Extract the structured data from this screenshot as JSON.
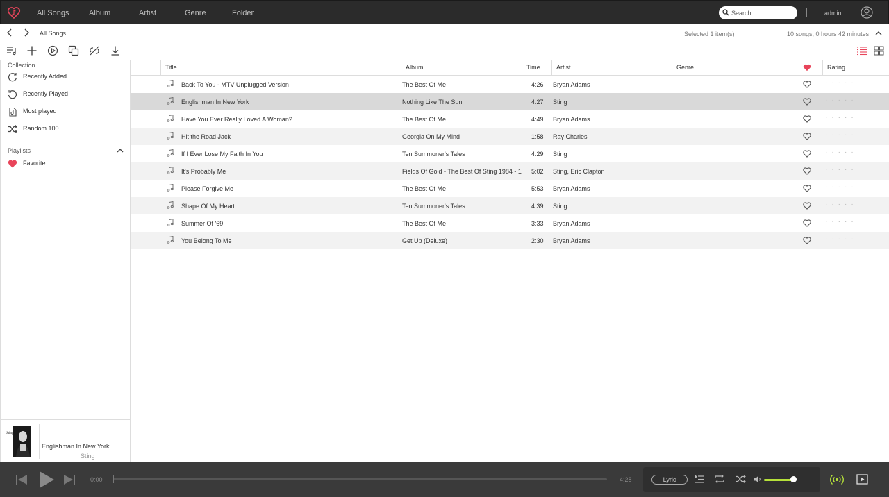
{
  "nav": {
    "items": [
      "All Songs",
      "Album",
      "Artist",
      "Genre",
      "Folder"
    ]
  },
  "search": {
    "placeholder": "Search"
  },
  "user": {
    "name": "admin"
  },
  "breadcrumb": "All Songs",
  "status": {
    "selected": "Selected 1 item(s)",
    "total": "10 songs, 0 hours 42 minutes"
  },
  "sidebar": {
    "collection_title": "Collection",
    "collection": [
      {
        "label": "Recently Added",
        "icon": "recently-added-icon"
      },
      {
        "label": "Recently Played",
        "icon": "recently-played-icon"
      },
      {
        "label": "Most played",
        "icon": "most-played-icon"
      },
      {
        "label": "Random 100",
        "icon": "shuffle-icon"
      }
    ],
    "playlists_title": "Playlists",
    "playlists": [
      {
        "label": "Favorite",
        "icon": "heart-icon"
      }
    ]
  },
  "table": {
    "headers": {
      "title": "Title",
      "album": "Album",
      "time": "Time",
      "artist": "Artist",
      "genre": "Genre",
      "rating": "Rating"
    },
    "selected_index": 1,
    "rows": [
      {
        "title": "Back To You - MTV Unplugged Version",
        "album": "The Best Of Me",
        "time": "4:26",
        "artist": "Bryan Adams",
        "genre": ""
      },
      {
        "title": "Englishman In New York",
        "album": "Nothing Like The Sun",
        "time": "4:27",
        "artist": "Sting",
        "genre": ""
      },
      {
        "title": "Have You Ever Really Loved A Woman?",
        "album": "The Best Of Me",
        "time": "4:49",
        "artist": "Bryan Adams",
        "genre": ""
      },
      {
        "title": "Hit the Road Jack",
        "album": "Georgia On My Mind",
        "time": "1:58",
        "artist": "Ray Charles",
        "genre": ""
      },
      {
        "title": "If I Ever Lose My Faith In You",
        "album": "Ten Summoner's Tales",
        "time": "4:29",
        "artist": "Sting",
        "genre": ""
      },
      {
        "title": "It's Probably Me",
        "album": "Fields Of Gold - The Best Of Sting 1984 - 1...",
        "time": "5:02",
        "artist": "Sting, Eric Clapton",
        "genre": ""
      },
      {
        "title": "Please Forgive Me",
        "album": "The Best Of Me",
        "time": "5:53",
        "artist": "Bryan Adams",
        "genre": ""
      },
      {
        "title": "Shape Of My Heart",
        "album": "Ten Summoner's Tales",
        "time": "4:39",
        "artist": "Sting",
        "genre": ""
      },
      {
        "title": "Summer Of '69",
        "album": "The Best Of Me",
        "time": "3:33",
        "artist": "Bryan Adams",
        "genre": ""
      },
      {
        "title": "You Belong To Me",
        "album": "Get Up (Deluxe)",
        "time": "2:30",
        "artist": "Bryan Adams",
        "genre": ""
      }
    ]
  },
  "now_playing": {
    "title": "Englishman In New York",
    "artist": "Sting",
    "cover_text": "Sting"
  },
  "player": {
    "current_time": "0:00",
    "total_time": "4:28",
    "progress": 0,
    "volume": 0.88,
    "lyric_label": "Lyric"
  },
  "colors": {
    "accent": "#e8445a",
    "topbar": "#2b2b2b",
    "player": "#3a3a3a",
    "volume": "#b6e13a"
  }
}
